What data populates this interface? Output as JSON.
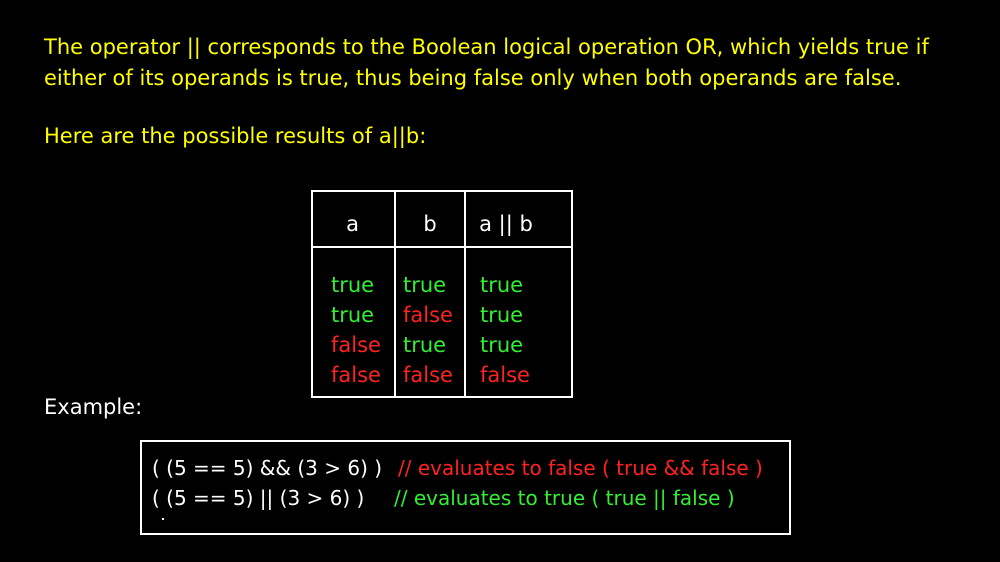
{
  "intro": {
    "text": "The operator || corresponds to the Boolean logical operation OR, which yields true if either of its operands is true, thus being false only when both operands are false."
  },
  "results_intro": "Here are the possible results of a||b:",
  "truth_table": {
    "headers": [
      "a",
      "b",
      "a || b"
    ],
    "rows": [
      {
        "a": "true",
        "b": "true",
        "result": "true"
      },
      {
        "a": "true",
        "b": "false",
        "result": "true"
      },
      {
        "a": "false",
        "b": "true",
        "result": "true"
      },
      {
        "a": "false",
        "b": "false",
        "result": "false"
      }
    ],
    "true_color": "#33ee33",
    "false_color": "#ff2222"
  },
  "example": {
    "label": "Example:",
    "lines": [
      {
        "code": "( (5 == 5) && (3 > 6) )",
        "comment": "// evaluates to false ( true && false )"
      },
      {
        "code": "( (5 == 5) || (3 > 6) )",
        "comment": "// evaluates to true ( true || false )"
      }
    ]
  },
  "colors": {
    "background": "#000000",
    "heading_text": "#ffff00",
    "body_text": "#ffffff"
  }
}
